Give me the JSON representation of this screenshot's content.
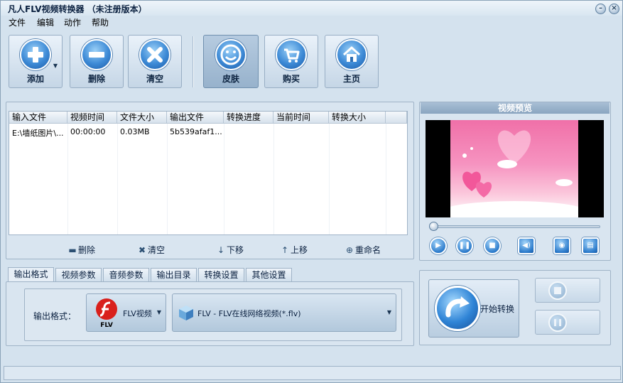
{
  "window": {
    "title": "凡人FLV视频转换器  （未注册版本）"
  },
  "window_controls": {
    "minimize": "–",
    "close": "×"
  },
  "menu": [
    "文件",
    "编辑",
    "动作",
    "帮助"
  ],
  "toolbar": {
    "add": "添加",
    "delete": "删除",
    "clear": "清空",
    "skin": "皮肤",
    "buy": "购买",
    "home": "主页"
  },
  "file_list": {
    "columns": [
      "输入文件",
      "视频时间",
      "文件大小",
      "输出文件",
      "转换进度",
      "当前时间",
      "转换大小"
    ],
    "rows": [
      [
        "E:\\墙纸图片\\...",
        "00:00:00",
        "0.03MB",
        "5b539afaf1...",
        "",
        "",
        ""
      ]
    ]
  },
  "list_actions": {
    "delete": "删除",
    "clear": "清空",
    "move_down": "下移",
    "move_up": "上移",
    "rename": "重命名"
  },
  "preview": {
    "title": "视频预览",
    "seek_position": 0
  },
  "tabs": [
    "输出格式",
    "视频参数",
    "音频参数",
    "输出目录",
    "转换设置",
    "其他设置"
  ],
  "output": {
    "label": "输出格式：",
    "format": "FLV视频",
    "format_icon_text": "FLV",
    "profile": "FLV - FLV在线网络视频(*.flv)"
  },
  "convert": {
    "start": "开始转换"
  },
  "colors": {
    "accent": "#2f84d6",
    "window_bg": "#d4e2ee"
  }
}
